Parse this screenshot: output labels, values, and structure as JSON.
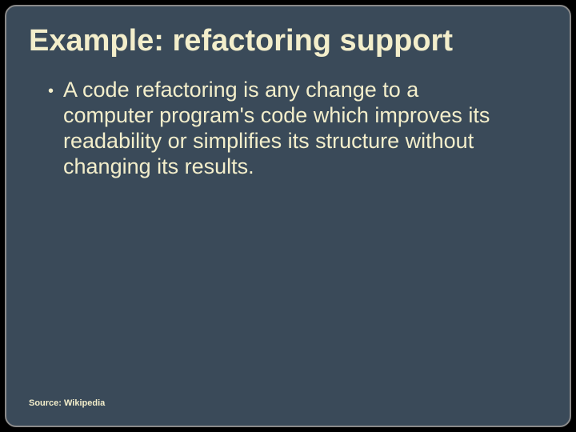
{
  "title": "Example: refactoring support",
  "bullet_glyph": "•",
  "body": "A code refactoring is any change to a computer program's code which improves its readability or simplifies its structure without changing its results.",
  "footer": "Source: Wikipedia"
}
